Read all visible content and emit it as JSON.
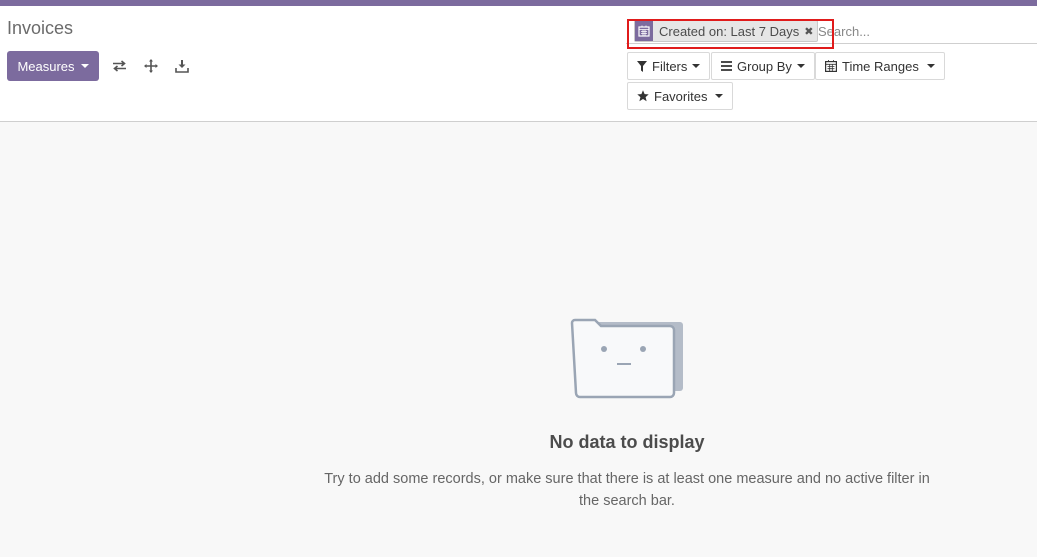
{
  "colors": {
    "brand": "#7c6b9e",
    "highlight": "#e01b1b",
    "background": "#f8f8f8"
  },
  "header": {
    "title": "Invoices"
  },
  "toolbar": {
    "measures_label": "Measures",
    "icons": [
      "flip-axis-icon",
      "expand-all-icon",
      "download-icon"
    ]
  },
  "search": {
    "facet": {
      "icon": "calendar-icon",
      "label": "Created on: Last 7 Days",
      "remove_icon": "close-icon"
    },
    "placeholder": "Search..."
  },
  "filters": {
    "filters_label": "Filters",
    "group_by_label": "Group By",
    "time_ranges_label": "Time Ranges",
    "favorites_label": "Favorites"
  },
  "empty_state": {
    "title": "No data to display",
    "message": "Try to add some records, or make sure that there is at least one measure and no active filter in the search bar."
  }
}
